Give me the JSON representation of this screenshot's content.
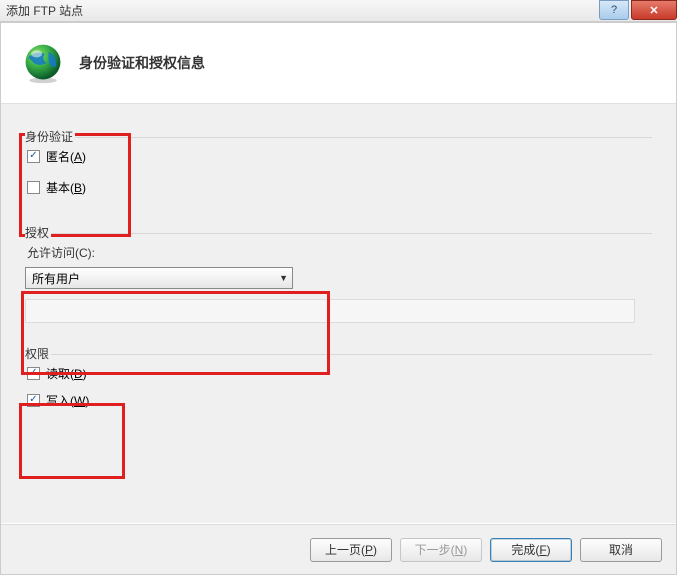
{
  "window": {
    "title": "添加 FTP 站点"
  },
  "header": {
    "title": "身份验证和授权信息"
  },
  "auth_section": {
    "legend": "身份验证",
    "anonymous": {
      "label_before": "匿名(",
      "hotkey": "A",
      "label_after": ")",
      "checked": true
    },
    "basic": {
      "label_before": "基本(",
      "hotkey": "B",
      "label_after": ")",
      "checked": false
    }
  },
  "authz_section": {
    "legend": "授权",
    "allow_access_label_before": "允许访问(",
    "allow_access_hotkey": "C",
    "allow_access_label_after": "):",
    "select_value": "所有用户"
  },
  "perm_section": {
    "legend": "权限",
    "read": {
      "label_before": "读取(",
      "hotkey": "D",
      "label_after": ")",
      "checked": true
    },
    "write": {
      "label_before": "写入(",
      "hotkey": "W",
      "label_after": ")",
      "checked": true
    }
  },
  "footer": {
    "prev": {
      "before": "上一页(",
      "hotkey": "P",
      "after": ")"
    },
    "next": {
      "before": "下一步(",
      "hotkey": "N",
      "after": ")"
    },
    "finish": {
      "before": "完成(",
      "hotkey": "F",
      "after": ")"
    },
    "cancel": {
      "label": "取消"
    }
  }
}
